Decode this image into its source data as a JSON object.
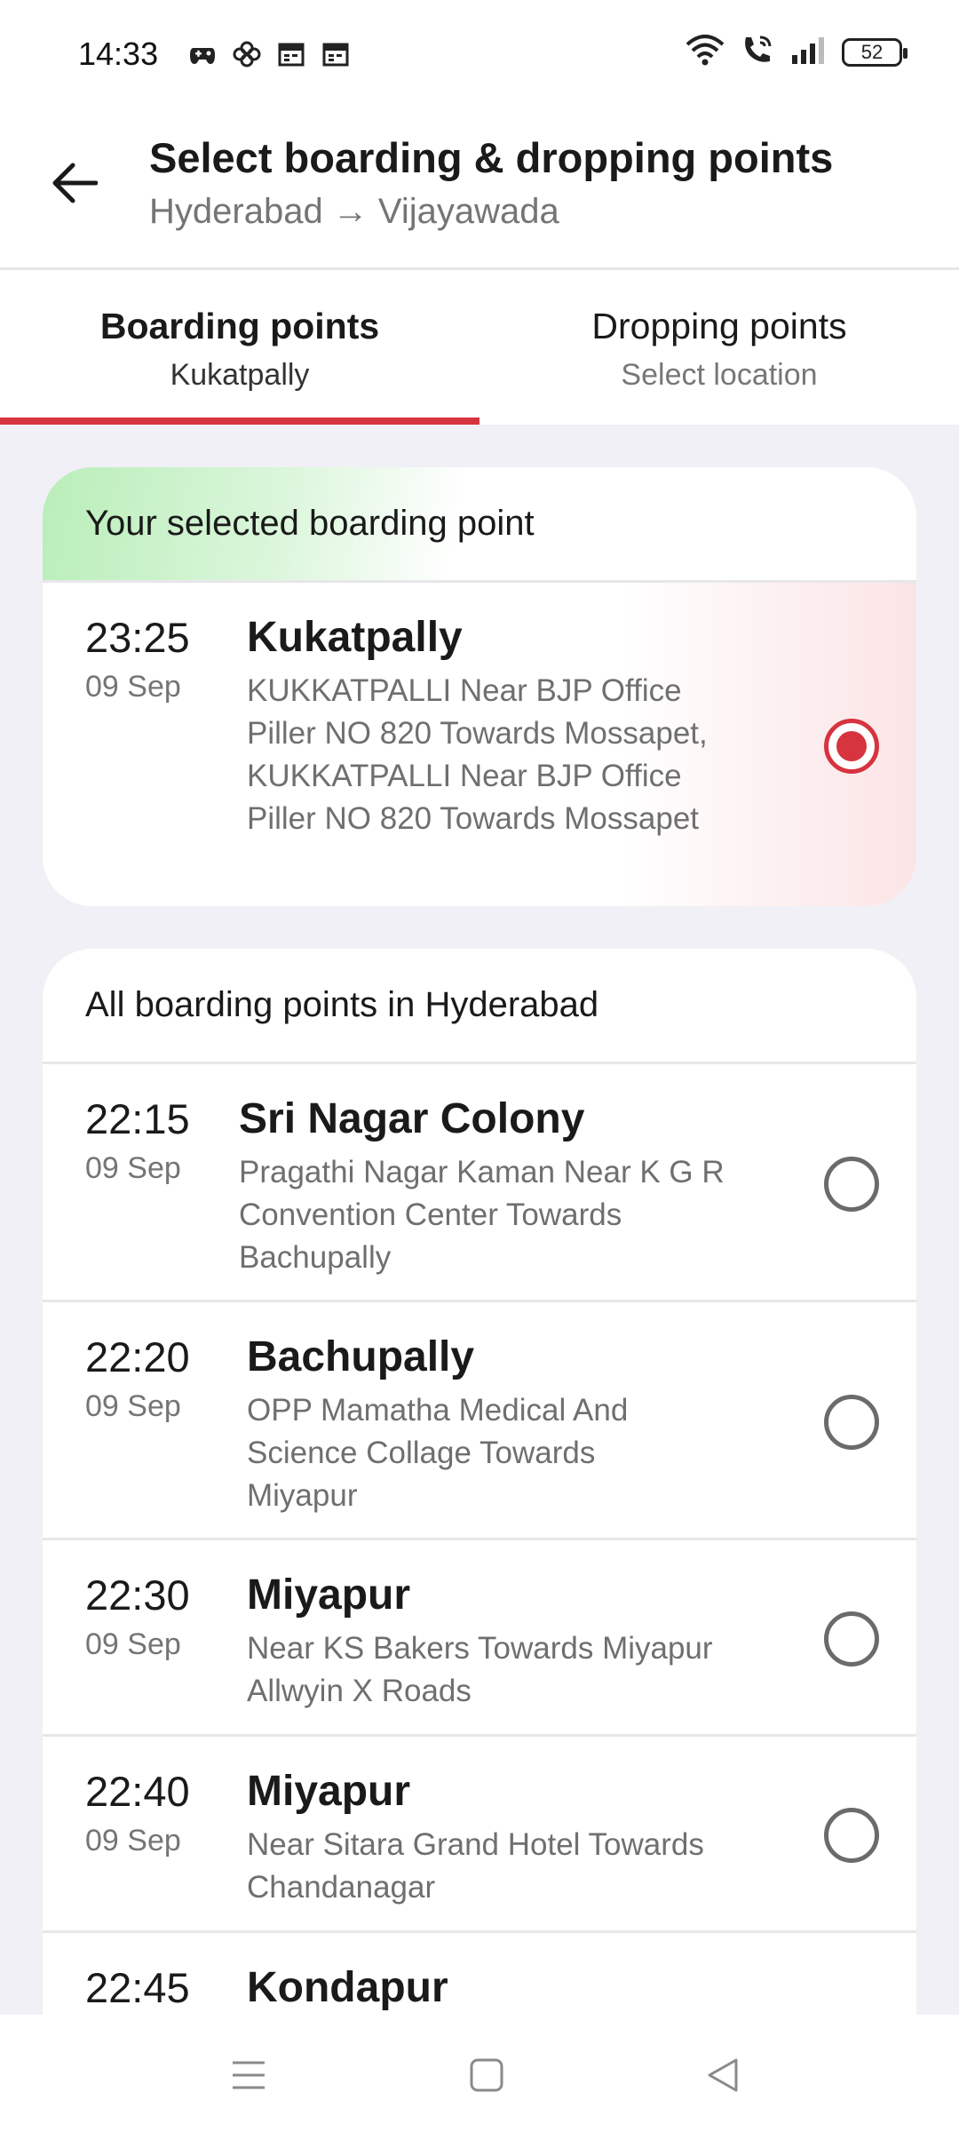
{
  "status_bar": {
    "time": "14:33",
    "battery": "52",
    "notification_icons": [
      "game-controller-icon",
      "pinwheel-icon",
      "calendar-icon",
      "calendar-icon"
    ],
    "system_icons": [
      "wifi-icon",
      "wifi-call-icon",
      "signal-icon",
      "battery-icon"
    ]
  },
  "header": {
    "title": "Select boarding & dropping points",
    "route": "Hyderabad → Vijayawada"
  },
  "tabs": [
    {
      "label": "Boarding points",
      "sub": "Kukatpally",
      "active": true
    },
    {
      "label": "Dropping points",
      "sub": "Select location",
      "active": false
    }
  ],
  "selected": {
    "heading": "Your selected boarding point",
    "point": {
      "time": "23:25",
      "date": "09 Sep",
      "name": "Kukatpally",
      "address": "KUKKATPALLI   Near BJP Office  Piller NO 820  Towards Mossapet, KUKKATPALLI   Near BJP Office  Piller NO 820  Towards Mossapet"
    }
  },
  "all_points": {
    "heading": "All boarding points in Hyderabad",
    "items": [
      {
        "time": "22:15",
        "date": "09 Sep",
        "name": "Sri Nagar Colony",
        "address": "Pragathi Nagar Kaman Near K G R Convention Center Towards Bachupally"
      },
      {
        "time": "22:20",
        "date": "09 Sep",
        "name": "Bachupally",
        "address": "OPP Mamatha Medical And Science Collage  Towards Miyapur"
      },
      {
        "time": "22:30",
        "date": "09 Sep",
        "name": "Miyapur",
        "address": "Near KS Bakers Towards Miyapur Allwyin X Roads"
      },
      {
        "time": "22:40",
        "date": "09 Sep",
        "name": "Miyapur",
        "address": "Near Sitara Grand Hotel Towards Chandanagar"
      },
      {
        "time": "22:45",
        "date": "",
        "name": "Kondapur",
        "address": ""
      }
    ]
  },
  "colors": {
    "accent": "#d6343f",
    "selected_header_green": "#b9eeb9",
    "background": "#f1f0f6"
  }
}
